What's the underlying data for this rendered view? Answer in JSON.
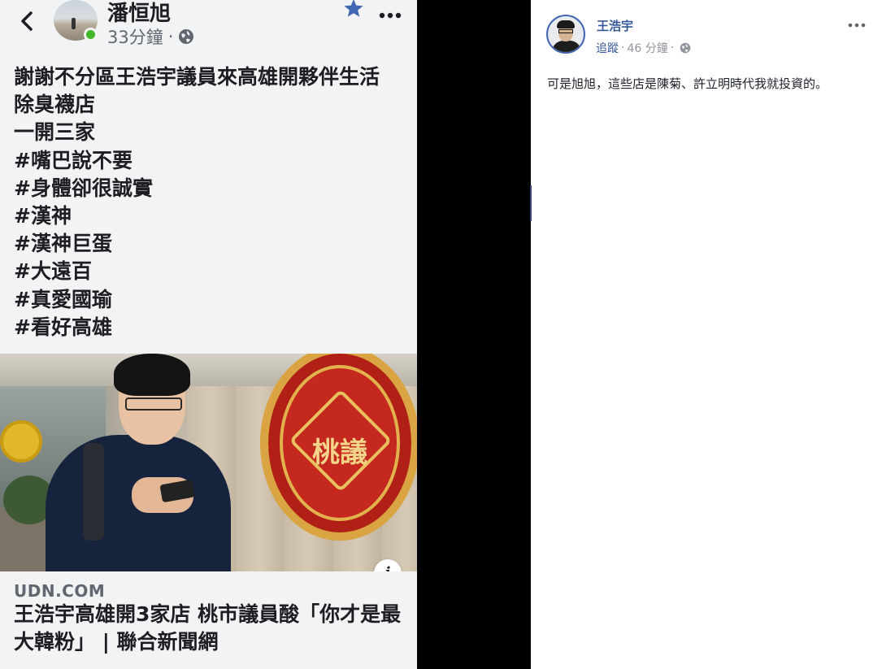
{
  "mobile_post": {
    "author": "潘恒旭",
    "time": "33分鐘",
    "meta_separator": "·",
    "text_lines": [
      "謝謝不分區王浩宇議員來高雄開夥伴生活",
      "除臭襪店",
      "一開三家",
      "#嘴巴說不要",
      "#身體卻很誠實",
      "#漢神",
      "#漢神巨蛋",
      "#大遠百",
      "#真愛國瑜",
      "#看好高雄"
    ],
    "photo_sign_text": "桃議",
    "info_label": "i",
    "link": {
      "domain": "UDN.COM",
      "title": "王浩宇高雄開3家店 桃市議員酸「你才是最大韓粉」 | 聯合新聞網"
    }
  },
  "desktop_comment": {
    "commenter_name": "王浩宇",
    "follow_label": "追蹤",
    "separator": "·",
    "time": "46 分鐘",
    "text": "可是旭旭，這些店是陳菊、許立明時代我就投資的。"
  },
  "colors": {
    "mobile_background": "#f2f3f5",
    "online_green": "#42b72a",
    "link_blue": "#365899",
    "star_blue": "#4267b2",
    "divider": "#000000"
  }
}
